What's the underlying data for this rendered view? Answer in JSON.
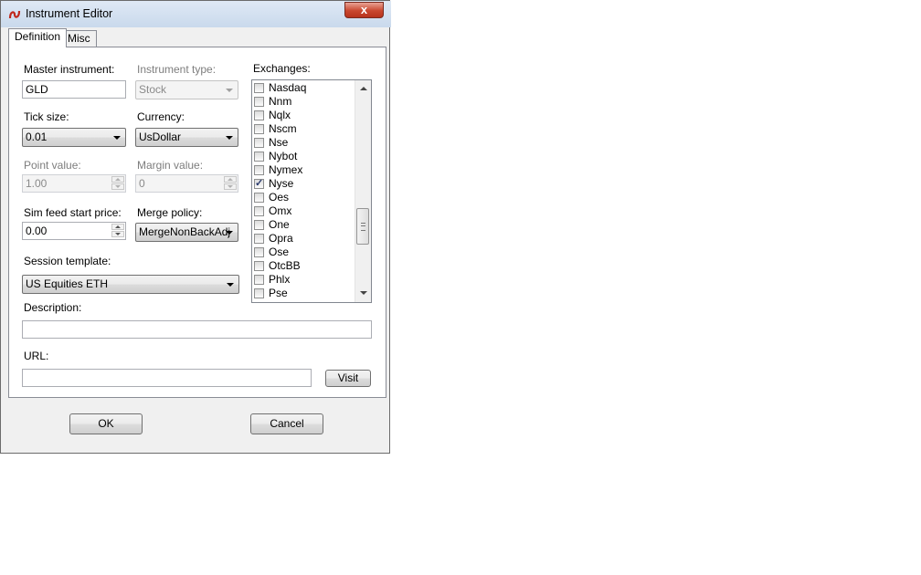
{
  "window": {
    "title": "Instrument Editor",
    "close_glyph": "x"
  },
  "tabs": [
    {
      "label": "Definition"
    },
    {
      "label": "Misc"
    }
  ],
  "fields": {
    "master_instrument": {
      "label": "Master instrument:",
      "value": "GLD"
    },
    "instrument_type": {
      "label": "Instrument type:",
      "value": "Stock"
    },
    "tick_size": {
      "label": "Tick size:",
      "value": "0.01"
    },
    "currency": {
      "label": "Currency:",
      "value": "UsDollar"
    },
    "point_value": {
      "label": "Point value:",
      "value": "1.00"
    },
    "margin_value": {
      "label": "Margin value:",
      "value": "0"
    },
    "sim_feed_start_price": {
      "label": "Sim feed start price:",
      "value": "0.00"
    },
    "merge_policy": {
      "label": "Merge policy:",
      "value": "MergeNonBackAdj"
    },
    "session_template": {
      "label": "Session template:",
      "value": "US Equities ETH"
    },
    "description": {
      "label": "Description:",
      "value": ""
    },
    "url": {
      "label": "URL:",
      "value": ""
    }
  },
  "exchanges": {
    "label": "Exchanges:",
    "items": [
      {
        "label": "Nasdaq",
        "checked": false
      },
      {
        "label": "Nnm",
        "checked": false
      },
      {
        "label": "Nqlx",
        "checked": false
      },
      {
        "label": "Nscm",
        "checked": false
      },
      {
        "label": "Nse",
        "checked": false
      },
      {
        "label": "Nybot",
        "checked": false
      },
      {
        "label": "Nymex",
        "checked": false
      },
      {
        "label": "Nyse",
        "checked": true
      },
      {
        "label": "Oes",
        "checked": false
      },
      {
        "label": "Omx",
        "checked": false
      },
      {
        "label": "One",
        "checked": false
      },
      {
        "label": "Opra",
        "checked": false
      },
      {
        "label": "Ose",
        "checked": false
      },
      {
        "label": "OtcBB",
        "checked": false
      },
      {
        "label": "Phlx",
        "checked": false
      },
      {
        "label": "Pse",
        "checked": false
      }
    ]
  },
  "buttons": {
    "visit": "Visit",
    "ok": "OK",
    "cancel": "Cancel"
  },
  "colors": {
    "titlebar": "#c9d9ec",
    "close_button": "#c9472f",
    "dialog_bg": "#f0f0f0"
  }
}
